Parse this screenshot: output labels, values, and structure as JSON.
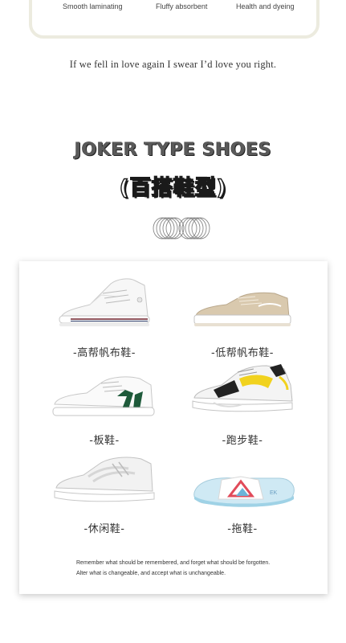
{
  "features": [
    "Smooth laminating",
    "Fluffy absorbent",
    "Health and dyeing"
  ],
  "quote": "If we fell in love again I swear I’d love you right.",
  "section": {
    "title": "JOKER TYPE SHOES",
    "subtitle": "(百搭鞋型)"
  },
  "shoes": [
    {
      "label": "-高帮帆布鞋-",
      "icon": "high-top-canvas-shoe-icon"
    },
    {
      "label": "-低帮帆布鞋-",
      "icon": "low-top-canvas-shoe-icon"
    },
    {
      "label": "-板鞋-",
      "icon": "skate-shoe-icon"
    },
    {
      "label": "-跑步鞋-",
      "icon": "running-shoe-icon"
    },
    {
      "label": "-休闲鞋-",
      "icon": "casual-shoe-icon"
    },
    {
      "label": "-拖鞋-",
      "icon": "slipper-icon"
    }
  ],
  "footer": {
    "line1": "Remember what should be remembered, and forget what should be forgotten.",
    "line2": "Alter what is changeable, and accept what is unchangeable."
  },
  "colors": {
    "card_border": "#ecebdf",
    "title_gray": "#5a5a5a",
    "text": "#333333"
  }
}
